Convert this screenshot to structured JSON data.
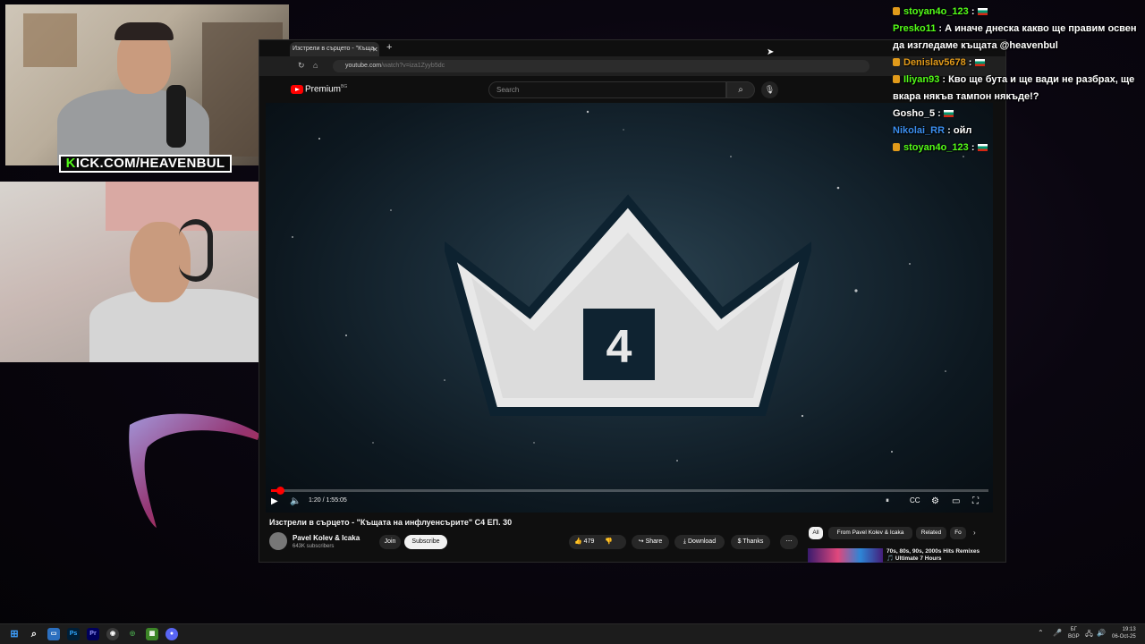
{
  "overlay": {
    "kick_prefix": "K",
    "kick_rest": "ICK.COM/HEAVENBUL"
  },
  "browser": {
    "tab_title": "Изстрели в сърцето - \"Къща",
    "url_host": "youtube.com",
    "url_rest": "/watch?v=iza1Zyyb5dc"
  },
  "youtube": {
    "brand": "Premium",
    "brand_sup": "BG",
    "search_placeholder": "Search",
    "time_current": "1:20",
    "time_total": "1:55:05",
    "progress_fraction": 0.012,
    "crown_number": "4",
    "video_title": "Изстрели в сърцето - \"Къщата на инфлуенсърите\" С4 ЕП. 30",
    "channel_name": "Pavel Kolev & Icaka",
    "channel_subs": "643K subscribers",
    "join_label": "Join",
    "subscribe_label": "Subscribe",
    "like_count": "479",
    "share_label": "Share",
    "download_label": "Download",
    "thanks_label": "Thanks",
    "chips": [
      "All",
      "From Pavel Kolev & Icaka",
      "Related",
      "Fo"
    ],
    "rec_title": "70s, 80s, 90s, 2000s Hits Remixes 🎵 Ultimate 7 Hours"
  },
  "chat": [
    {
      "user": "stoyan4o_123",
      "color": "#53fc18",
      "badge": true,
      "text": "",
      "flag": true
    },
    {
      "user": "Presko11",
      "color": "#53fc18",
      "badge": false,
      "text": "А иначе днеска какво ще правим освен да изгледаме къщата @heavenbul",
      "flag": false
    },
    {
      "user": "Denislav5678",
      "color": "#e19a1a",
      "badge": true,
      "text": "",
      "flag": true
    },
    {
      "user": "Iliyan93",
      "color": "#53fc18",
      "badge": true,
      "text": "Кво ще бута и ще вади не разбрах, ще вкара някъв тампон някъде!?",
      "flag": false
    },
    {
      "user": "Gosho_5",
      "color": "#ffffff",
      "badge": false,
      "text": "",
      "flag": true
    },
    {
      "user": "Nikolai_RR",
      "color": "#3b8ff0",
      "badge": false,
      "text": "ойл",
      "flag": false
    },
    {
      "user": "stoyan4o_123",
      "color": "#53fc18",
      "badge": true,
      "text": "",
      "flag": true
    }
  ],
  "taskbar": {
    "lang_top": "БГ",
    "lang_bottom": "BGP",
    "time": "19:13",
    "date": "06-Oct-25"
  },
  "colors": {
    "kick_green": "#53fc18",
    "yt_red": "#ff0000",
    "badge_orange": "#e19a1a"
  }
}
